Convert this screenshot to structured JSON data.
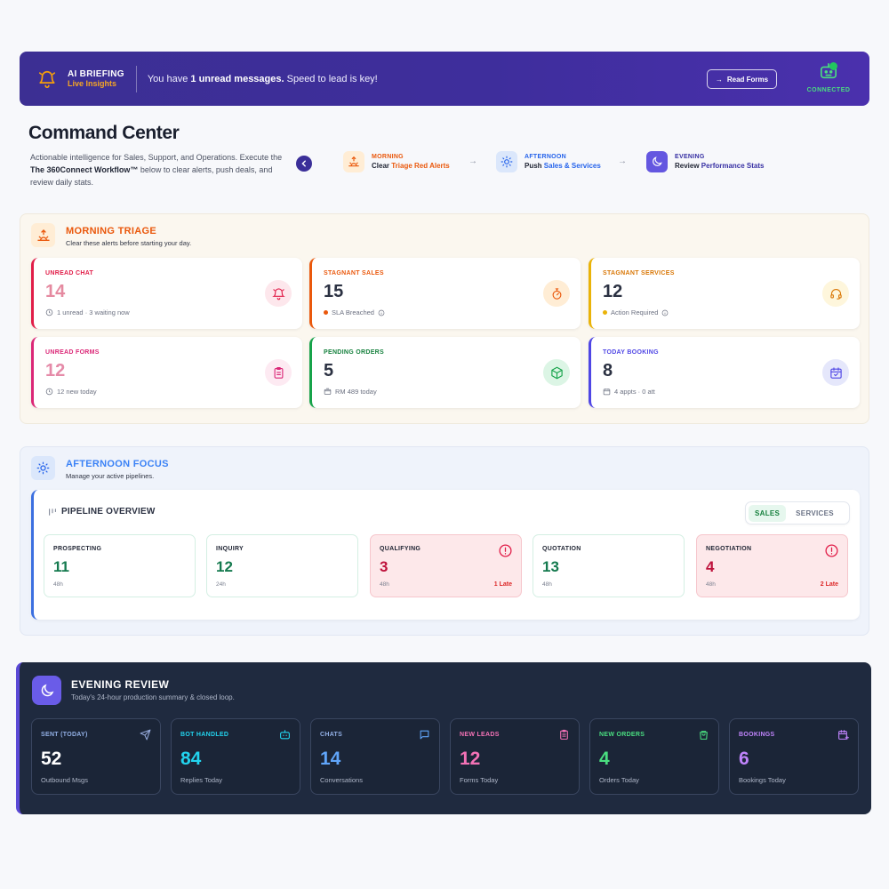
{
  "banner": {
    "title": "AI BRIEFING",
    "subtitle": "Live Insights",
    "message_pre": "You have ",
    "message_bold": "1 unread messages.",
    "message_post": " Speed to lead is key!",
    "button_label": "Read Forms",
    "status": "CONNECTED"
  },
  "header": {
    "title": "Command Center",
    "desc_pre": "Actionable intelligence for Sales, Support, and Operations. Execute the ",
    "desc_bold": "The 360Connect Workflow™",
    "desc_post": " below to clear alerts, push deals, and review daily stats."
  },
  "workflow": [
    {
      "phase": "MORNING",
      "action_pre": "Clear ",
      "action_hl": "Triage Red Alerts",
      "color": "#ea580c"
    },
    {
      "phase": "AFTERNOON",
      "action_pre": "Push ",
      "action_hl": "Sales & Services",
      "color": "#2563eb"
    },
    {
      "phase": "EVENING",
      "action_pre": "Review ",
      "action_hl": "Performance Stats",
      "color": "#4338ca"
    }
  ],
  "morning": {
    "title": "MORNING TRIAGE",
    "subtitle": "Clear these alerts before starting your day.",
    "cards": [
      {
        "label": "UNREAD CHAT",
        "value": "14",
        "foot": "1 unread · 3 waiting now",
        "color": "#e11d48"
      },
      {
        "label": "STAGNANT SALES",
        "value": "15",
        "foot": "SLA Breached",
        "color": "#ea580c"
      },
      {
        "label": "STAGNANT SERVICES",
        "value": "12",
        "foot": "Action Required",
        "color": "#eab308"
      },
      {
        "label": "UNREAD FORMS",
        "value": "12",
        "foot": "12 new today",
        "color": "#db2777"
      },
      {
        "label": "PENDING ORDERS",
        "value": "5",
        "foot": "RM 489 today",
        "color": "#16a34a"
      },
      {
        "label": "TODAY BOOKING",
        "value": "8",
        "foot": "4 appts · 0 att",
        "color": "#4f46e5"
      }
    ]
  },
  "afternoon": {
    "title": "AFTERNOON FOCUS",
    "subtitle": "Manage your active pipelines.",
    "pipeline_title": "PIPELINE OVERVIEW",
    "toggle": [
      "SALES",
      "SERVICES"
    ],
    "stages": [
      {
        "label": "PROSPECTING",
        "value": "11",
        "duration": "48h",
        "late": ""
      },
      {
        "label": "INQUIRY",
        "value": "12",
        "duration": "24h",
        "late": ""
      },
      {
        "label": "QUALIFYING",
        "value": "3",
        "duration": "48h",
        "late": "1 Late"
      },
      {
        "label": "QUOTATION",
        "value": "13",
        "duration": "48h",
        "late": ""
      },
      {
        "label": "NEGOTIATION",
        "value": "4",
        "duration": "48h",
        "late": "2 Late"
      }
    ]
  },
  "evening": {
    "title": "EVENING REVIEW",
    "subtitle": "Today's 24-hour production summary & closed loop.",
    "stats": [
      {
        "label": "SENT (TODAY)",
        "value": "52",
        "foot": "Outbound Msgs",
        "color": "#93a7d8",
        "label_color": "#93b0e6"
      },
      {
        "label": "BOT HANDLED",
        "value": "84",
        "foot": "Replies Today",
        "color": "#22d3ee",
        "label_color": "#22d3ee"
      },
      {
        "label": "CHATS",
        "value": "14",
        "foot": "Conversations",
        "color": "#60a5fa",
        "label_color": "#93b0e6"
      },
      {
        "label": "NEW LEADS",
        "value": "12",
        "foot": "Forms Today",
        "color": "#f472b6",
        "label_color": "#f472b6"
      },
      {
        "label": "NEW ORDERS",
        "value": "4",
        "foot": "Orders Today",
        "color": "#4ade80",
        "label_color": "#4ade80"
      },
      {
        "label": "BOOKINGS",
        "value": "6",
        "foot": "Bookings Today",
        "color": "#c084fc",
        "label_color": "#c084fc"
      }
    ]
  }
}
